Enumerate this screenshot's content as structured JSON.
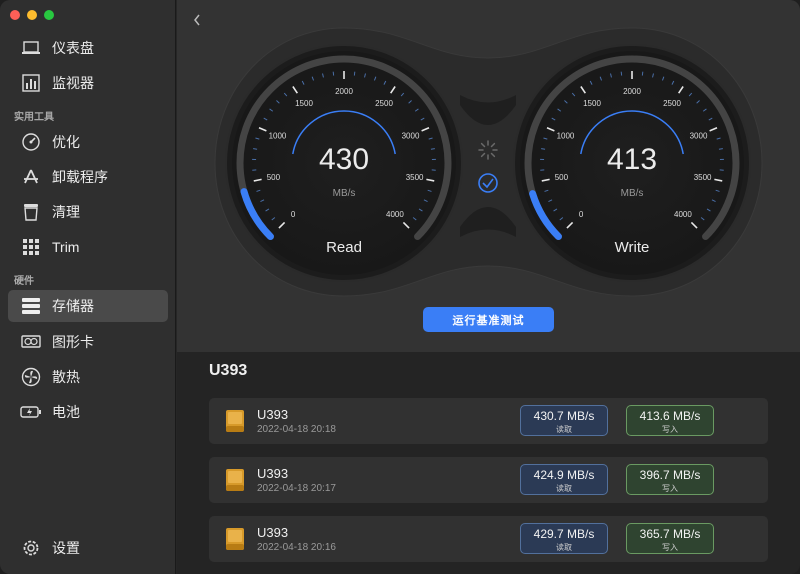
{
  "sidebar": {
    "items": [
      {
        "label": "仪表盘",
        "icon": "laptop-icon"
      },
      {
        "label": "监视器",
        "icon": "chart-icon"
      },
      {
        "label": "优化",
        "icon": "speedometer-icon"
      },
      {
        "label": "卸载程序",
        "icon": "app-store-icon"
      },
      {
        "label": "清理",
        "icon": "trash-icon"
      },
      {
        "label": "Trim",
        "icon": "grid-icon"
      },
      {
        "label": "存储器",
        "icon": "storage-icon"
      },
      {
        "label": "图形卡",
        "icon": "gpu-icon"
      },
      {
        "label": "散热",
        "icon": "fan-icon"
      },
      {
        "label": "电池",
        "icon": "battery-icon"
      },
      {
        "label": "设置",
        "icon": "gear-icon"
      }
    ],
    "sections": {
      "tools": "实用工具",
      "hardware": "硬件"
    },
    "active": "存储器"
  },
  "gauges": {
    "ticks": [
      "0",
      "500",
      "1000",
      "1500",
      "2000",
      "2500",
      "3000",
      "3500",
      "4000"
    ],
    "unit": "MB/s",
    "max": 4000,
    "read": {
      "value": "430",
      "label": "Read",
      "level": 430
    },
    "write": {
      "value": "413",
      "label": "Write",
      "level": 413
    }
  },
  "benchmark_button": "运行基准测试",
  "drive": {
    "title": "U393",
    "results": [
      {
        "name": "U393",
        "date": "2022-04-18 20:18",
        "read": "430.7 MB/s",
        "write": "413.6 MB/s"
      },
      {
        "name": "U393",
        "date": "2022-04-18 20:17",
        "read": "424.9 MB/s",
        "write": "396.7 MB/s"
      },
      {
        "name": "U393",
        "date": "2022-04-18 20:16",
        "read": "429.7 MB/s",
        "write": "365.7 MB/s"
      }
    ],
    "read_label": "读取",
    "write_label": "写入"
  },
  "colors": {
    "accent": "#3a7ef6",
    "read_border": "#52709c",
    "write_border": "#6a9a62"
  }
}
